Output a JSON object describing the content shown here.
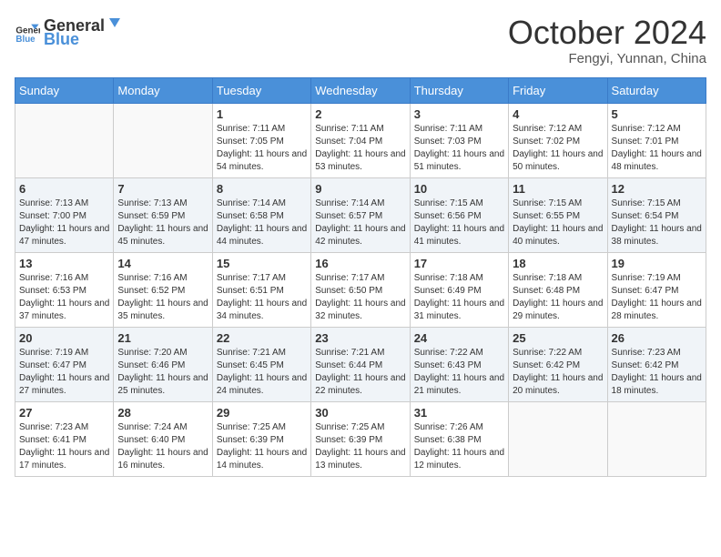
{
  "header": {
    "logo_general": "General",
    "logo_blue": "Blue",
    "title": "October 2024",
    "subtitle": "Fengyi, Yunnan, China"
  },
  "weekdays": [
    "Sunday",
    "Monday",
    "Tuesday",
    "Wednesday",
    "Thursday",
    "Friday",
    "Saturday"
  ],
  "weeks": [
    [
      {
        "day": "",
        "sunrise": "",
        "sunset": "",
        "daylight": "",
        "empty": true
      },
      {
        "day": "",
        "sunrise": "",
        "sunset": "",
        "daylight": "",
        "empty": true
      },
      {
        "day": "1",
        "sunrise": "Sunrise: 7:11 AM",
        "sunset": "Sunset: 7:05 PM",
        "daylight": "Daylight: 11 hours and 54 minutes.",
        "empty": false
      },
      {
        "day": "2",
        "sunrise": "Sunrise: 7:11 AM",
        "sunset": "Sunset: 7:04 PM",
        "daylight": "Daylight: 11 hours and 53 minutes.",
        "empty": false
      },
      {
        "day": "3",
        "sunrise": "Sunrise: 7:11 AM",
        "sunset": "Sunset: 7:03 PM",
        "daylight": "Daylight: 11 hours and 51 minutes.",
        "empty": false
      },
      {
        "day": "4",
        "sunrise": "Sunrise: 7:12 AM",
        "sunset": "Sunset: 7:02 PM",
        "daylight": "Daylight: 11 hours and 50 minutes.",
        "empty": false
      },
      {
        "day": "5",
        "sunrise": "Sunrise: 7:12 AM",
        "sunset": "Sunset: 7:01 PM",
        "daylight": "Daylight: 11 hours and 48 minutes.",
        "empty": false
      }
    ],
    [
      {
        "day": "6",
        "sunrise": "Sunrise: 7:13 AM",
        "sunset": "Sunset: 7:00 PM",
        "daylight": "Daylight: 11 hours and 47 minutes.",
        "empty": false
      },
      {
        "day": "7",
        "sunrise": "Sunrise: 7:13 AM",
        "sunset": "Sunset: 6:59 PM",
        "daylight": "Daylight: 11 hours and 45 minutes.",
        "empty": false
      },
      {
        "day": "8",
        "sunrise": "Sunrise: 7:14 AM",
        "sunset": "Sunset: 6:58 PM",
        "daylight": "Daylight: 11 hours and 44 minutes.",
        "empty": false
      },
      {
        "day": "9",
        "sunrise": "Sunrise: 7:14 AM",
        "sunset": "Sunset: 6:57 PM",
        "daylight": "Daylight: 11 hours and 42 minutes.",
        "empty": false
      },
      {
        "day": "10",
        "sunrise": "Sunrise: 7:15 AM",
        "sunset": "Sunset: 6:56 PM",
        "daylight": "Daylight: 11 hours and 41 minutes.",
        "empty": false
      },
      {
        "day": "11",
        "sunrise": "Sunrise: 7:15 AM",
        "sunset": "Sunset: 6:55 PM",
        "daylight": "Daylight: 11 hours and 40 minutes.",
        "empty": false
      },
      {
        "day": "12",
        "sunrise": "Sunrise: 7:15 AM",
        "sunset": "Sunset: 6:54 PM",
        "daylight": "Daylight: 11 hours and 38 minutes.",
        "empty": false
      }
    ],
    [
      {
        "day": "13",
        "sunrise": "Sunrise: 7:16 AM",
        "sunset": "Sunset: 6:53 PM",
        "daylight": "Daylight: 11 hours and 37 minutes.",
        "empty": false
      },
      {
        "day": "14",
        "sunrise": "Sunrise: 7:16 AM",
        "sunset": "Sunset: 6:52 PM",
        "daylight": "Daylight: 11 hours and 35 minutes.",
        "empty": false
      },
      {
        "day": "15",
        "sunrise": "Sunrise: 7:17 AM",
        "sunset": "Sunset: 6:51 PM",
        "daylight": "Daylight: 11 hours and 34 minutes.",
        "empty": false
      },
      {
        "day": "16",
        "sunrise": "Sunrise: 7:17 AM",
        "sunset": "Sunset: 6:50 PM",
        "daylight": "Daylight: 11 hours and 32 minutes.",
        "empty": false
      },
      {
        "day": "17",
        "sunrise": "Sunrise: 7:18 AM",
        "sunset": "Sunset: 6:49 PM",
        "daylight": "Daylight: 11 hours and 31 minutes.",
        "empty": false
      },
      {
        "day": "18",
        "sunrise": "Sunrise: 7:18 AM",
        "sunset": "Sunset: 6:48 PM",
        "daylight": "Daylight: 11 hours and 29 minutes.",
        "empty": false
      },
      {
        "day": "19",
        "sunrise": "Sunrise: 7:19 AM",
        "sunset": "Sunset: 6:47 PM",
        "daylight": "Daylight: 11 hours and 28 minutes.",
        "empty": false
      }
    ],
    [
      {
        "day": "20",
        "sunrise": "Sunrise: 7:19 AM",
        "sunset": "Sunset: 6:47 PM",
        "daylight": "Daylight: 11 hours and 27 minutes.",
        "empty": false
      },
      {
        "day": "21",
        "sunrise": "Sunrise: 7:20 AM",
        "sunset": "Sunset: 6:46 PM",
        "daylight": "Daylight: 11 hours and 25 minutes.",
        "empty": false
      },
      {
        "day": "22",
        "sunrise": "Sunrise: 7:21 AM",
        "sunset": "Sunset: 6:45 PM",
        "daylight": "Daylight: 11 hours and 24 minutes.",
        "empty": false
      },
      {
        "day": "23",
        "sunrise": "Sunrise: 7:21 AM",
        "sunset": "Sunset: 6:44 PM",
        "daylight": "Daylight: 11 hours and 22 minutes.",
        "empty": false
      },
      {
        "day": "24",
        "sunrise": "Sunrise: 7:22 AM",
        "sunset": "Sunset: 6:43 PM",
        "daylight": "Daylight: 11 hours and 21 minutes.",
        "empty": false
      },
      {
        "day": "25",
        "sunrise": "Sunrise: 7:22 AM",
        "sunset": "Sunset: 6:42 PM",
        "daylight": "Daylight: 11 hours and 20 minutes.",
        "empty": false
      },
      {
        "day": "26",
        "sunrise": "Sunrise: 7:23 AM",
        "sunset": "Sunset: 6:42 PM",
        "daylight": "Daylight: 11 hours and 18 minutes.",
        "empty": false
      }
    ],
    [
      {
        "day": "27",
        "sunrise": "Sunrise: 7:23 AM",
        "sunset": "Sunset: 6:41 PM",
        "daylight": "Daylight: 11 hours and 17 minutes.",
        "empty": false
      },
      {
        "day": "28",
        "sunrise": "Sunrise: 7:24 AM",
        "sunset": "Sunset: 6:40 PM",
        "daylight": "Daylight: 11 hours and 16 minutes.",
        "empty": false
      },
      {
        "day": "29",
        "sunrise": "Sunrise: 7:25 AM",
        "sunset": "Sunset: 6:39 PM",
        "daylight": "Daylight: 11 hours and 14 minutes.",
        "empty": false
      },
      {
        "day": "30",
        "sunrise": "Sunrise: 7:25 AM",
        "sunset": "Sunset: 6:39 PM",
        "daylight": "Daylight: 11 hours and 13 minutes.",
        "empty": false
      },
      {
        "day": "31",
        "sunrise": "Sunrise: 7:26 AM",
        "sunset": "Sunset: 6:38 PM",
        "daylight": "Daylight: 11 hours and 12 minutes.",
        "empty": false
      },
      {
        "day": "",
        "sunrise": "",
        "sunset": "",
        "daylight": "",
        "empty": true
      },
      {
        "day": "",
        "sunrise": "",
        "sunset": "",
        "daylight": "",
        "empty": true
      }
    ]
  ]
}
